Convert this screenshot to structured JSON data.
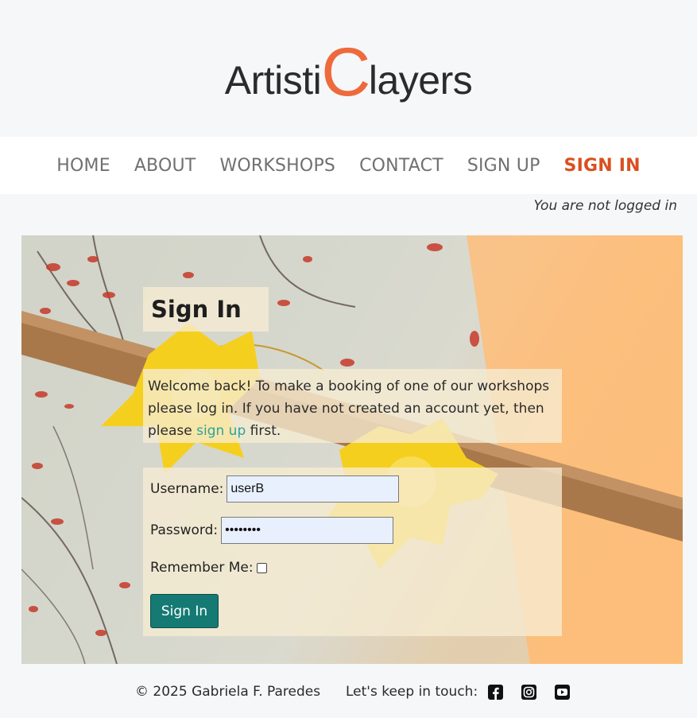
{
  "logo": {
    "prefix": "Artisti",
    "highlight": "C",
    "suffix": "layers"
  },
  "nav": {
    "items": [
      {
        "label": "HOME"
      },
      {
        "label": "ABOUT"
      },
      {
        "label": "WORKSHOPS"
      },
      {
        "label": "CONTACT"
      },
      {
        "label": "SIGN UP"
      },
      {
        "label": "SIGN IN",
        "active": true
      }
    ]
  },
  "status": "You are not logged in",
  "signin": {
    "title": "Sign In",
    "message_part1": "Welcome back! To make a booking of one of our workshops please log in. If you have not created an account yet, then please ",
    "message_link": "sign up",
    "message_part2": " first.",
    "username_label": "Username:",
    "username_value": "userB",
    "password_label": "Password:",
    "password_value": "••••••••",
    "remember_label": "Remember Me:",
    "remember_checked": false,
    "button_label": "Sign In"
  },
  "footer": {
    "copyright": "© 2025 Gabriela F. Paredes",
    "keep_in_touch": "Let's keep in touch:",
    "social_icons": [
      "facebook-icon",
      "instagram-icon",
      "youtube-icon"
    ]
  },
  "colors": {
    "accent": "#d9501e",
    "logo_c": "#ee6a3c",
    "button": "#157a74",
    "link": "#2fa39a"
  }
}
